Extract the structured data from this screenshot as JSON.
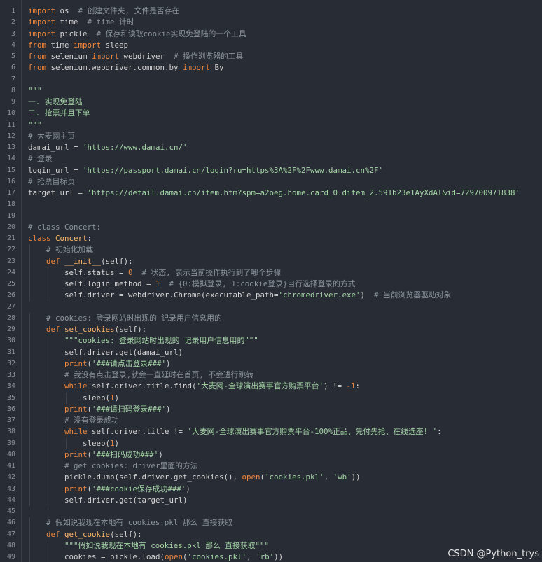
{
  "watermark": "CSDN @Python_trys",
  "lines": [
    {
      "n": "1",
      "parts": [
        [
          "kw",
          "import"
        ],
        [
          "t",
          " os  "
        ],
        [
          "cmt",
          "# 创建文件夹, 文件是否存在"
        ]
      ]
    },
    {
      "n": "2",
      "parts": [
        [
          "kw",
          "import"
        ],
        [
          "t",
          " time  "
        ],
        [
          "cmt",
          "# time 计时"
        ]
      ]
    },
    {
      "n": "3",
      "parts": [
        [
          "kw",
          "import"
        ],
        [
          "t",
          " pickle  "
        ],
        [
          "cmt",
          "# 保存和读取cookie实现免登陆的一个工具"
        ]
      ]
    },
    {
      "n": "4",
      "parts": [
        [
          "kw",
          "from"
        ],
        [
          "t",
          " time "
        ],
        [
          "kw",
          "import"
        ],
        [
          "t",
          " sleep"
        ]
      ]
    },
    {
      "n": "5",
      "parts": [
        [
          "kw",
          "from"
        ],
        [
          "t",
          " selenium "
        ],
        [
          "kw",
          "import"
        ],
        [
          "t",
          " webdriver  "
        ],
        [
          "cmt",
          "# 操作浏览器的工具"
        ]
      ]
    },
    {
      "n": "6",
      "parts": [
        [
          "kw",
          "from"
        ],
        [
          "t",
          " selenium.webdriver.common.by "
        ],
        [
          "kw",
          "import"
        ],
        [
          "t",
          " By"
        ]
      ]
    },
    {
      "n": "7",
      "parts": []
    },
    {
      "n": "8",
      "parts": [
        [
          "str",
          "\"\"\""
        ]
      ]
    },
    {
      "n": "9",
      "parts": [
        [
          "str",
          "一. 实现免登陆"
        ]
      ]
    },
    {
      "n": "10",
      "parts": [
        [
          "str",
          "二. 抢票并且下单"
        ]
      ]
    },
    {
      "n": "11",
      "parts": [
        [
          "str",
          "\"\"\""
        ]
      ]
    },
    {
      "n": "12",
      "parts": [
        [
          "cmt",
          "# 大麦网主页"
        ]
      ]
    },
    {
      "n": "13",
      "parts": [
        [
          "t",
          "damai_url = "
        ],
        [
          "str",
          "'https://www.damai.cn/'"
        ]
      ]
    },
    {
      "n": "14",
      "parts": [
        [
          "cmt",
          "# 登录"
        ]
      ]
    },
    {
      "n": "15",
      "parts": [
        [
          "t",
          "login_url = "
        ],
        [
          "str",
          "'https://passport.damai.cn/login?ru=https%3A%2F%2Fwww.damai.cn%2F'"
        ]
      ]
    },
    {
      "n": "16",
      "parts": [
        [
          "cmt",
          "# 抢票目标页"
        ]
      ]
    },
    {
      "n": "17",
      "parts": [
        [
          "t",
          "target_url = "
        ],
        [
          "str",
          "'https://detail.damai.cn/item.htm?spm=a2oeg.home.card_0.ditem_2.591b23e1AyXdAl&id=729700971838'"
        ]
      ]
    },
    {
      "n": "18",
      "parts": []
    },
    {
      "n": "19",
      "parts": []
    },
    {
      "n": "20",
      "parts": [
        [
          "cmt",
          "# class Concert:"
        ]
      ]
    },
    {
      "n": "21",
      "parts": [
        [
          "kw",
          "class"
        ],
        [
          "t",
          " "
        ],
        [
          "cls",
          "Concert"
        ],
        [
          "t",
          ":"
        ]
      ]
    },
    {
      "n": "22",
      "parts": [
        [
          "t",
          "    "
        ],
        [
          "cmt",
          "# 初始化加载"
        ]
      ]
    },
    {
      "n": "23",
      "parts": [
        [
          "t",
          "    "
        ],
        [
          "kw",
          "def"
        ],
        [
          "t",
          " "
        ],
        [
          "fn",
          "__init__"
        ],
        [
          "t",
          "(self):"
        ]
      ]
    },
    {
      "n": "24",
      "parts": [
        [
          "t",
          "        self.status = "
        ],
        [
          "num",
          "0"
        ],
        [
          "t",
          "  "
        ],
        [
          "cmt",
          "# 状态, 表示当前操作执行到了哪个步骤"
        ]
      ]
    },
    {
      "n": "25",
      "parts": [
        [
          "t",
          "        self.login_method = "
        ],
        [
          "num",
          "1"
        ],
        [
          "t",
          "  "
        ],
        [
          "cmt",
          "# {0:模拟登录, 1:cookie登录}自行选择登录的方式"
        ]
      ]
    },
    {
      "n": "26",
      "parts": [
        [
          "t",
          "        self.driver = webdriver.Chrome(executable_path="
        ],
        [
          "str",
          "'chromedriver.exe'"
        ],
        [
          "t",
          ")  "
        ],
        [
          "cmt",
          "# 当前浏览器驱动对象"
        ]
      ]
    },
    {
      "n": "27",
      "parts": []
    },
    {
      "n": "28",
      "parts": [
        [
          "t",
          "    "
        ],
        [
          "cmt",
          "# cookies: 登录网站时出现的 记录用户信息用的"
        ]
      ]
    },
    {
      "n": "29",
      "parts": [
        [
          "t",
          "    "
        ],
        [
          "kw",
          "def"
        ],
        [
          "t",
          " "
        ],
        [
          "fn",
          "set_cookies"
        ],
        [
          "t",
          "(self):"
        ]
      ]
    },
    {
      "n": "30",
      "parts": [
        [
          "t",
          "        "
        ],
        [
          "str",
          "\"\"\"cookies: 登录网站时出现的 记录用户信息用的\"\"\""
        ]
      ]
    },
    {
      "n": "31",
      "parts": [
        [
          "t",
          "        self.driver.get(damai_url)"
        ]
      ]
    },
    {
      "n": "32",
      "parts": [
        [
          "t",
          "        "
        ],
        [
          "kw",
          "print"
        ],
        [
          "t",
          "("
        ],
        [
          "str",
          "'###请点击登录###'"
        ],
        [
          "t",
          ")"
        ]
      ]
    },
    {
      "n": "33",
      "parts": [
        [
          "t",
          "        "
        ],
        [
          "cmt",
          "# 我没有点击登录,就会一直延时在首页, 不会进行跳转"
        ]
      ]
    },
    {
      "n": "34",
      "parts": [
        [
          "t",
          "        "
        ],
        [
          "kw",
          "while"
        ],
        [
          "t",
          " self.driver.title.find("
        ],
        [
          "str",
          "'大麦网-全球演出赛事官方购票平台'"
        ],
        [
          "t",
          ") != "
        ],
        [
          "num",
          "-1"
        ],
        [
          "t",
          ":"
        ]
      ]
    },
    {
      "n": "35",
      "parts": [
        [
          "t",
          "            sleep("
        ],
        [
          "num",
          "1"
        ],
        [
          "t",
          ")"
        ]
      ]
    },
    {
      "n": "36",
      "parts": [
        [
          "t",
          "        "
        ],
        [
          "kw",
          "print"
        ],
        [
          "t",
          "("
        ],
        [
          "str",
          "'###请扫码登录###'"
        ],
        [
          "t",
          ")"
        ]
      ]
    },
    {
      "n": "37",
      "parts": [
        [
          "t",
          "        "
        ],
        [
          "cmt",
          "# 没有登录成功"
        ]
      ]
    },
    {
      "n": "38",
      "parts": [
        [
          "t",
          "        "
        ],
        [
          "kw",
          "while"
        ],
        [
          "t",
          " self.driver.title != "
        ],
        [
          "str",
          "'大麦网-全球演出赛事官方购票平台-100%正品、先付先抢、在线选座! '"
        ],
        [
          "t",
          ":"
        ]
      ]
    },
    {
      "n": "39",
      "parts": [
        [
          "t",
          "            sleep("
        ],
        [
          "num",
          "1"
        ],
        [
          "t",
          ")"
        ]
      ]
    },
    {
      "n": "40",
      "parts": [
        [
          "t",
          "        "
        ],
        [
          "kw",
          "print"
        ],
        [
          "t",
          "("
        ],
        [
          "str",
          "'###扫码成功###'"
        ],
        [
          "t",
          ")"
        ]
      ]
    },
    {
      "n": "41",
      "parts": [
        [
          "t",
          "        "
        ],
        [
          "cmt",
          "# get_cookies: driver里面的方法"
        ]
      ]
    },
    {
      "n": "42",
      "parts": [
        [
          "t",
          "        pickle.dump(self.driver.get_cookies(), "
        ],
        [
          "kw",
          "open"
        ],
        [
          "t",
          "("
        ],
        [
          "str",
          "'cookies.pkl'"
        ],
        [
          "t",
          ", "
        ],
        [
          "str",
          "'wb'"
        ],
        [
          "t",
          "))"
        ]
      ]
    },
    {
      "n": "43",
      "parts": [
        [
          "t",
          "        "
        ],
        [
          "kw",
          "print"
        ],
        [
          "t",
          "("
        ],
        [
          "str",
          "'###cookie保存成功###'"
        ],
        [
          "t",
          ")"
        ]
      ]
    },
    {
      "n": "44",
      "parts": [
        [
          "t",
          "        self.driver.get(target_url)"
        ]
      ]
    },
    {
      "n": "45",
      "parts": []
    },
    {
      "n": "46",
      "parts": [
        [
          "t",
          "    "
        ],
        [
          "cmt",
          "# 假如说我现在本地有 cookies.pkl 那么 直接获取"
        ]
      ]
    },
    {
      "n": "47",
      "parts": [
        [
          "t",
          "    "
        ],
        [
          "kw",
          "def"
        ],
        [
          "t",
          " "
        ],
        [
          "fn",
          "get_cookie"
        ],
        [
          "t",
          "(self):"
        ]
      ]
    },
    {
      "n": "48",
      "parts": [
        [
          "t",
          "        "
        ],
        [
          "str",
          "\"\"\"假如说我现在本地有 cookies.pkl 那么 直接获取\"\"\""
        ]
      ]
    },
    {
      "n": "49",
      "parts": [
        [
          "t",
          "        cookies = pickle.load("
        ],
        [
          "kw",
          "open"
        ],
        [
          "t",
          "("
        ],
        [
          "str",
          "'cookies.pkl'"
        ],
        [
          "t",
          ", "
        ],
        [
          "str",
          "'rb'"
        ],
        [
          "t",
          "))"
        ]
      ]
    }
  ]
}
